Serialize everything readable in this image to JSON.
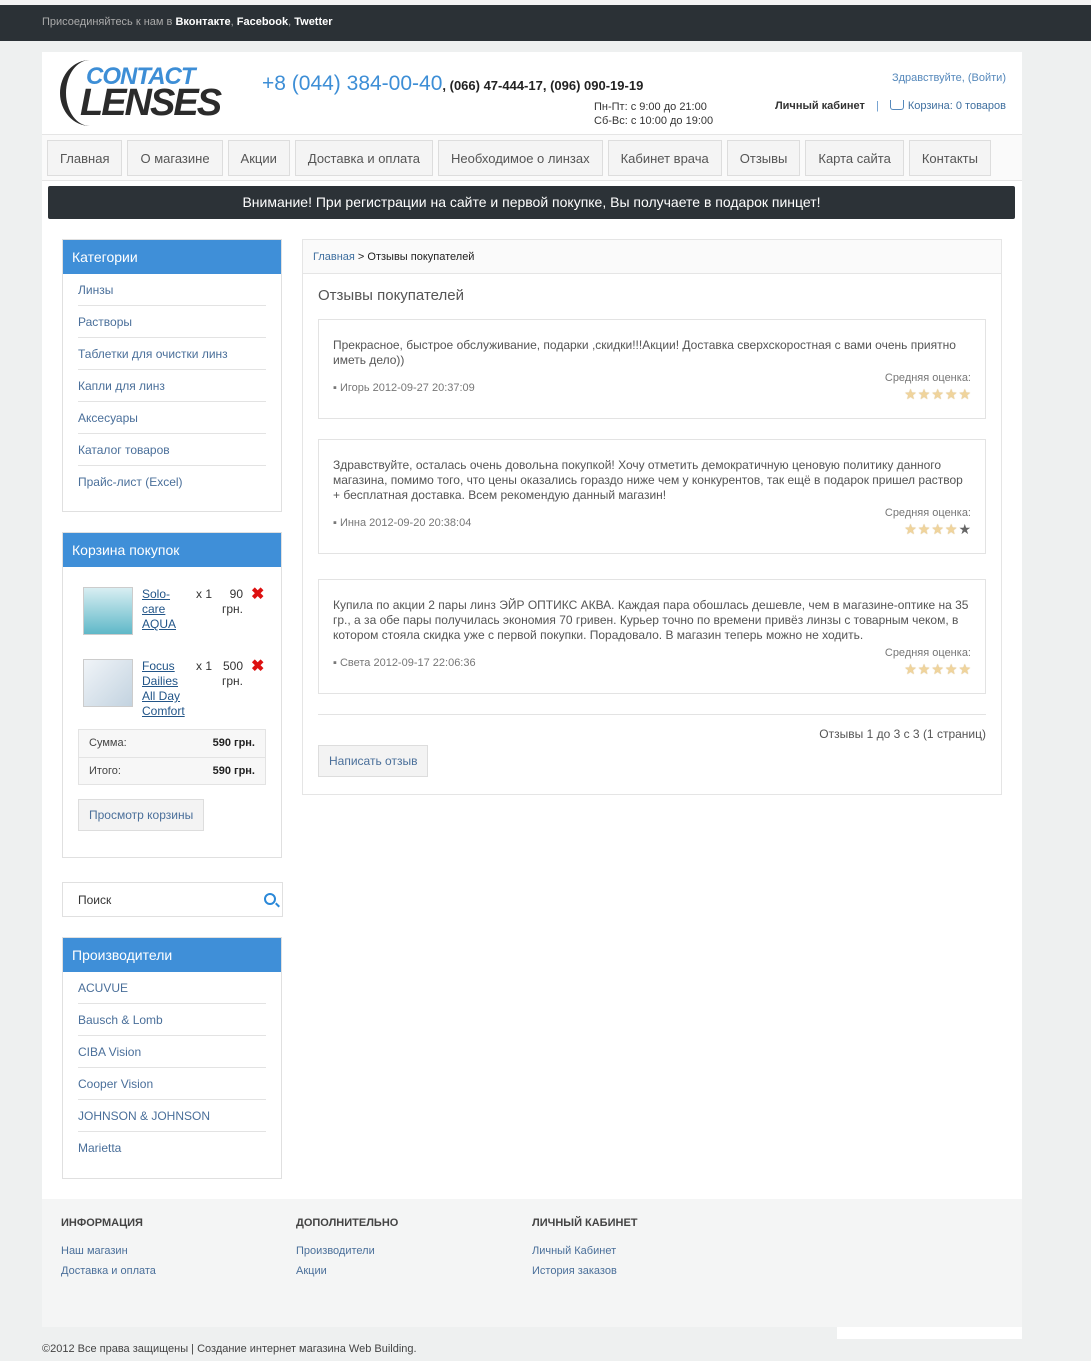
{
  "topbar": {
    "text": "Присоединяйтесь к нам в",
    "links": [
      "Вконтакте",
      "Facebook",
      "Twetter"
    ]
  },
  "logo": {
    "line1": "CONTACT",
    "line2": "LENSES"
  },
  "header": {
    "phone_main": "+8 (044) 384-00-40",
    "phone_extra": ", (066) 47-444-17, (096) 090-19-19",
    "hours1": "Пн-Пт: с 9:00 до 21:00",
    "hours2": "Сб-Вс: с 10:00 до 19:00",
    "hello": "Здравствуйте, (Войти)",
    "account": "Личный кабинет",
    "cart": "Корзина: 0 товаров"
  },
  "nav": [
    "Главная",
    "О магазине",
    "Акции",
    "Доставка и оплата",
    "Необходимое о линзах",
    "Кабинет врача",
    "Отзывы",
    "Карта сайта",
    "Контакты"
  ],
  "notice": "Внимание! При регистрации на сайте и первой покупке, Вы получаете в подарок пинцет!",
  "categories": {
    "title": "Категории",
    "items": [
      "Линзы",
      "Растворы",
      "Таблетки для очистки линз",
      "Капли для линз",
      "Аксесуары",
      "Каталог товаров",
      "Прайс-лист (Excel)"
    ]
  },
  "cart_box": {
    "title": "Корзина покупок",
    "items": [
      {
        "name": "Solo-care AQUA",
        "qty": "x 1",
        "price": "90 грн."
      },
      {
        "name": "Focus Dailies All Day Comfort",
        "qty": "x 1",
        "price": "500 грн."
      }
    ],
    "sum_label": "Сумма:",
    "sum_value": "590 грн.",
    "total_label": "Итого:",
    "total_value": "590 грн.",
    "view_button": "Просмотр корзины"
  },
  "search": {
    "value": "Поиск"
  },
  "manufacturers": {
    "title": "Производители",
    "items": [
      "ACUVUE",
      "Bausch & Lomb",
      "CIBA Vision",
      "Cooper Vision",
      "JOHNSON & JOHNSON",
      "Marietta"
    ]
  },
  "breadcrumb": {
    "home": "Главная",
    "current": " > Отзывы покупателей"
  },
  "page_title": "Отзывы покупателей",
  "reviews": [
    {
      "text": "Прекрасное, быстрое обслуживание, подарки ,скидки!!!Акции! Доставка сверхскоростная с вами очень приятно иметь дело))",
      "author": "▪ Игорь 2012-09-27 20:37:09",
      "rating_label": "Средняя оценка:",
      "rating": 5
    },
    {
      "text": "Здравствуйте, осталась очень довольна покупкой! Хочу отметить демократичную ценовую политику данного магазина, помимо того, что цены оказались гораздо ниже чем у конкурентов, так ещё в подарок пришел раствор + бесплатная доставка. Всем рекомендую данный магазин!",
      "author": "▪ Инна 2012-09-20 20:38:04",
      "rating_label": "Средняя оценка:",
      "rating": 4
    },
    {
      "text": "Купила по акции 2 пары линз ЭЙР ОПТИКС АКВА. Каждая пара обошлась дешевле, чем в магазине-оптике на 35 гр., а за обе пары получилась экономия 70 гривен. Курьер точно по времени привёз линзы с товарным чеком, в котором стояла скидка уже с первой покупки. Порадовало. В магазин теперь можно не ходить.",
      "author": "▪ Света 2012-09-17 22:06:36",
      "rating_label": "Средняя оценка:",
      "rating": 5
    }
  ],
  "pager": "Отзывы 1 до 3 с 3 (1 страниц)",
  "write_button": "Написать отзыв",
  "footer": {
    "cols": [
      {
        "title": "ИНФОРМАЦИЯ",
        "links": [
          "Наш магазин",
          "Доставка и оплата"
        ]
      },
      {
        "title": "ДОПОЛНИТЕЛЬНО",
        "links": [
          "Производители",
          "Акции"
        ]
      },
      {
        "title": "ЛИЧНЫЙ КАБИНЕТ",
        "links": [
          "Личный Кабинет",
          "История заказов"
        ]
      }
    ],
    "copyright": "©2012 Все права защищены | Создание интернет магазина Web Building."
  },
  "colors": {
    "accent": "#3f8fd8",
    "dark": "#2b3136",
    "star": "#f0d49c",
    "remove": "#dd1111"
  },
  "icons": [
    "cart-icon",
    "search-icon",
    "remove-icon",
    "star-icon"
  ]
}
